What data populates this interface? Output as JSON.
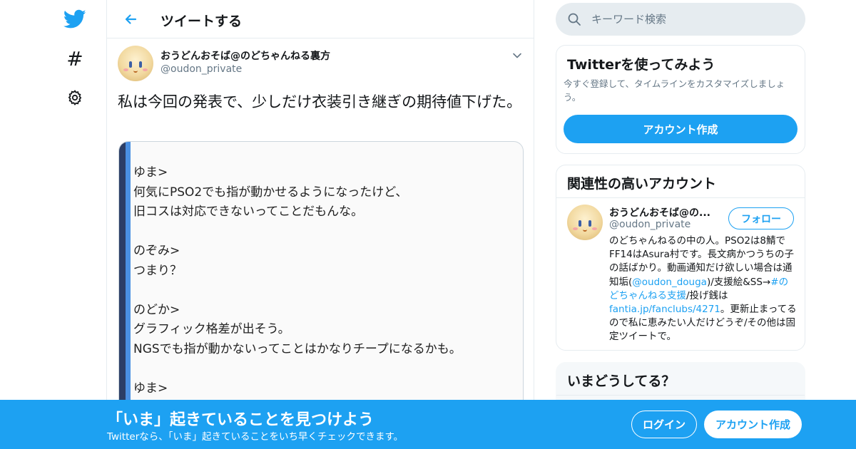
{
  "header": {
    "title": "ツイートする"
  },
  "tweet": {
    "author_name": "おうどんおそば@のどちゃんねる裏方",
    "author_handle": "@oudon_private",
    "text": "私は今回の発表で、少しだけ衣装引き継ぎの期待値下げた。",
    "image_lines": [
      "ゆま>",
      "何気にPSO2でも指が動かせるようになったけど、",
      "旧コスは対応できないってことだもんな。",
      "",
      "のぞみ>",
      "つまり？",
      "",
      "のどか>",
      "グラフィック格差が出そう。",
      "NGSでも指が動かないってことはかなりチープになるかも。",
      "",
      "ゆま>"
    ]
  },
  "search": {
    "placeholder": "キーワード検索"
  },
  "signup_card": {
    "title": "Twitterを使ってみよう",
    "description": "今すぐ登録して、タイムラインをカスタマイズしましょう。",
    "button": "アカウント作成"
  },
  "related_card": {
    "title": "関連性の高いアカウント",
    "name": "おうどんおそば@の...",
    "handle": "@oudon_private",
    "follow_label": "フォロー",
    "bio": {
      "part1": "のどちゃんねるの中の人。PSO2は8鯖でFF14はAsura村です。長文病かつうちの子の話ばかり。動画通知だけ欲しい場合は通知垢(",
      "link1": "@oudon_douga",
      "part2": ")/支援絵&SS→",
      "link2": "#のどちゃんねる支援",
      "part3": "/投げ銭は",
      "link3": "fantia.jp/fanclubs/4271",
      "part4": "。更新止まってるので私に恵みたい人だけどうぞ/その他は固定ツイートで。"
    }
  },
  "trends_card": {
    "title": "いまどうしてる？"
  },
  "banner": {
    "title": "「いま」起きていることを見つけよう",
    "subtitle": "Twitterなら、「いま」起きていることをいち早くチェックできます。",
    "login": "ログイン",
    "signup": "アカウント作成"
  },
  "colors": {
    "accent": "#1da1f2",
    "border": "#e6ecf0",
    "muted": "#657786"
  }
}
